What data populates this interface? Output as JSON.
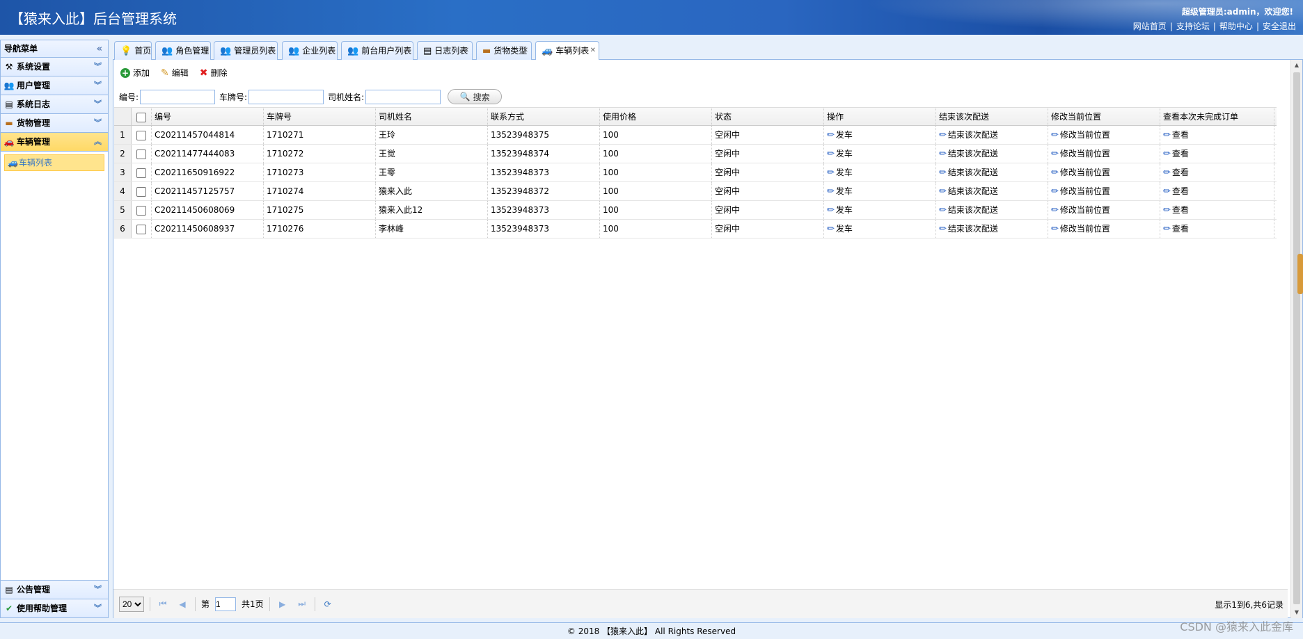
{
  "header": {
    "title": "【猿来入此】后台管理系统",
    "user_text": "超级管理员:admin，欢迎您!",
    "links": [
      "网站首页",
      "支持论坛",
      "帮助中心",
      "安全退出"
    ]
  },
  "sidebar": {
    "title": "导航菜单",
    "collapse_icon": "«",
    "menus": [
      {
        "label": "系统设置",
        "icon": "⚒",
        "chev": "︾"
      },
      {
        "label": "用户管理",
        "icon": "👥",
        "chev": "︾"
      },
      {
        "label": "系统日志",
        "icon": "▤",
        "chev": "︾"
      },
      {
        "label": "货物管理",
        "icon": "▬",
        "chev": "︾"
      },
      {
        "label": "车辆管理",
        "icon": "🚗",
        "chev": "︽"
      }
    ],
    "sub_item": {
      "label": "车辆列表",
      "icon": "🚙"
    },
    "bottom_menus": [
      {
        "label": "公告管理",
        "icon": "▤",
        "chev": "︾"
      },
      {
        "label": "使用帮助管理",
        "icon": "✔",
        "chev": "︾"
      }
    ]
  },
  "tabs": [
    {
      "label": "首页",
      "icon": "💡",
      "closable": false
    },
    {
      "label": "角色管理",
      "icon": "👥",
      "closable": true
    },
    {
      "label": "管理员列表",
      "icon": "👥",
      "closable": true
    },
    {
      "label": "企业列表",
      "icon": "👥",
      "closable": true
    },
    {
      "label": "前台用户列表",
      "icon": "👥",
      "closable": true
    },
    {
      "label": "日志列表",
      "icon": "▤",
      "closable": true
    },
    {
      "label": "货物类型",
      "icon": "▬",
      "closable": true
    },
    {
      "label": "车辆列表",
      "icon": "🚙",
      "closable": true
    }
  ],
  "toolbar": {
    "add_label": "添加",
    "edit_label": "编辑",
    "delete_label": "删除"
  },
  "search": {
    "sn_label": "编号:",
    "plate_label": "车牌号:",
    "driver_label": "司机姓名:",
    "button_label": "搜索"
  },
  "grid": {
    "columns": [
      "编号",
      "车牌号",
      "司机姓名",
      "联系方式",
      "使用价格",
      "状态",
      "操作",
      "结束该次配送",
      "修改当前位置",
      "查看本次未完成订单"
    ],
    "rows": [
      {
        "n": "1",
        "sn": "C20211457044814",
        "plate": "1710271",
        "driver": "王玲",
        "phone": "13523948375",
        "price": "100",
        "status": "空闲中"
      },
      {
        "n": "2",
        "sn": "C20211477444083",
        "plate": "1710272",
        "driver": "王觉",
        "phone": "13523948374",
        "price": "100",
        "status": "空闲中"
      },
      {
        "n": "3",
        "sn": "C20211650916922",
        "plate": "1710273",
        "driver": "王零",
        "phone": "13523948373",
        "price": "100",
        "status": "空闲中"
      },
      {
        "n": "4",
        "sn": "C20211457125757",
        "plate": "1710274",
        "driver": "猿来入此",
        "phone": "13523948372",
        "price": "100",
        "status": "空闲中"
      },
      {
        "n": "5",
        "sn": "C20211450608069",
        "plate": "1710275",
        "driver": "猿来入此12",
        "phone": "13523948373",
        "price": "100",
        "status": "空闲中"
      },
      {
        "n": "6",
        "sn": "C20211450608937",
        "plate": "1710276",
        "driver": "李林峰",
        "phone": "13523948373",
        "price": "100",
        "status": "空闲中"
      }
    ],
    "actions": {
      "dispatch": "发车",
      "end": "结束该次配送",
      "move": "修改当前位置",
      "view": "查看"
    }
  },
  "pager": {
    "page_size": "20",
    "page_prefix": "第",
    "page_value": "1",
    "page_suffix": "共1页",
    "info": "显示1到6,共6记录"
  },
  "footer": "© 2018 【猿来入此】 All Rights Reserved",
  "watermark": "CSDN @猿来入此金库",
  "colors": {
    "accent": "#95b8e7",
    "active_menu": "#ffe48d",
    "header": "#2a66c0"
  }
}
